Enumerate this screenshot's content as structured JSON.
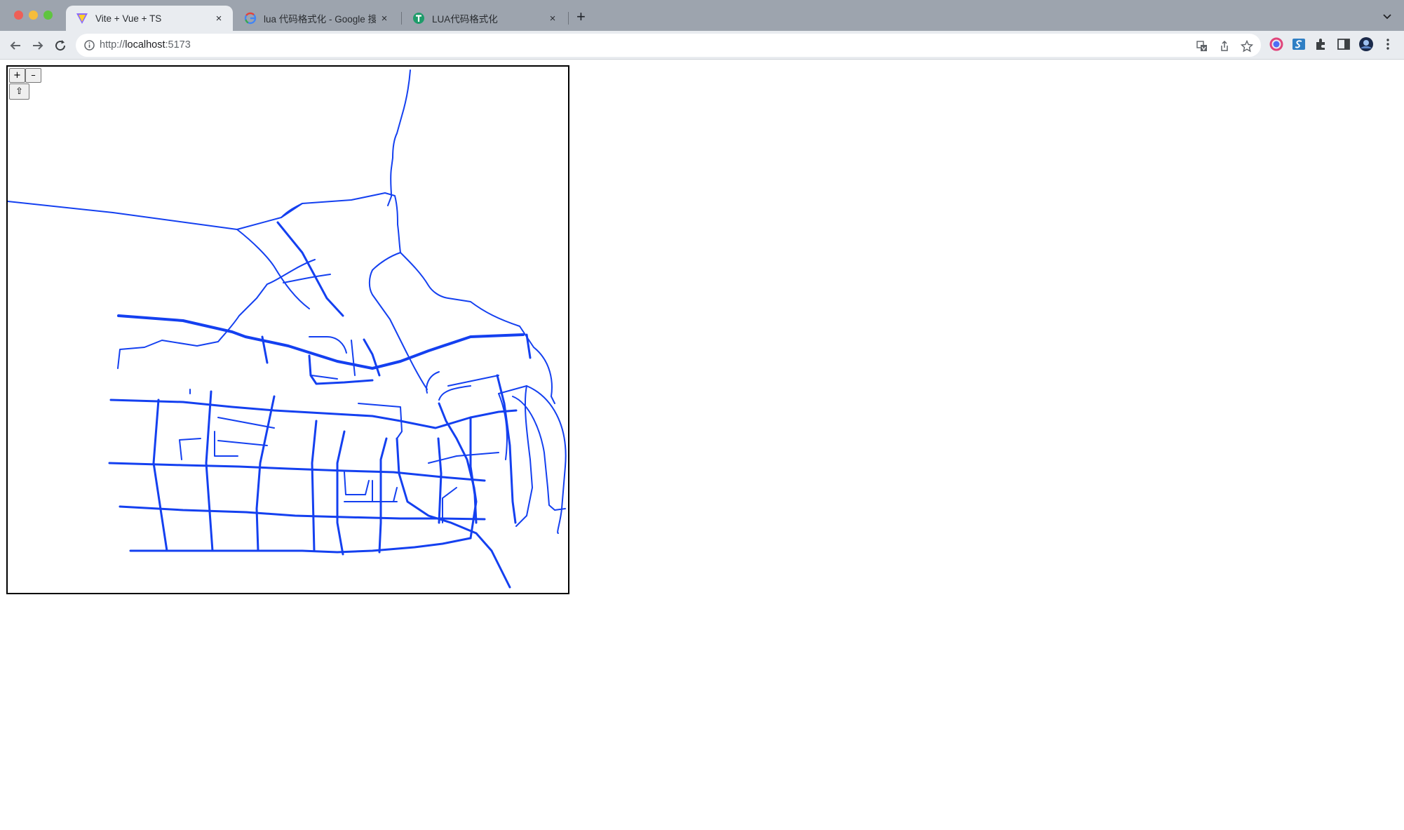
{
  "browser": {
    "tabs": [
      {
        "title": "Vite + Vue + TS",
        "active": true,
        "favicon": "vite-icon"
      },
      {
        "title": "lua 代码格式化 - Google 搜索",
        "active": false,
        "favicon": "google-icon"
      },
      {
        "title": "LUA代码格式化",
        "active": false,
        "favicon": "tool-site-icon"
      }
    ],
    "tab_close": "×",
    "new_tab": "+",
    "url_scheme": "http://",
    "url_host": "localhost",
    "url_port": ":5173"
  },
  "map": {
    "zoom_in_label": "+",
    "zoom_out_label": "–",
    "reset_label": "⇧",
    "road_color": "#1440f0"
  }
}
